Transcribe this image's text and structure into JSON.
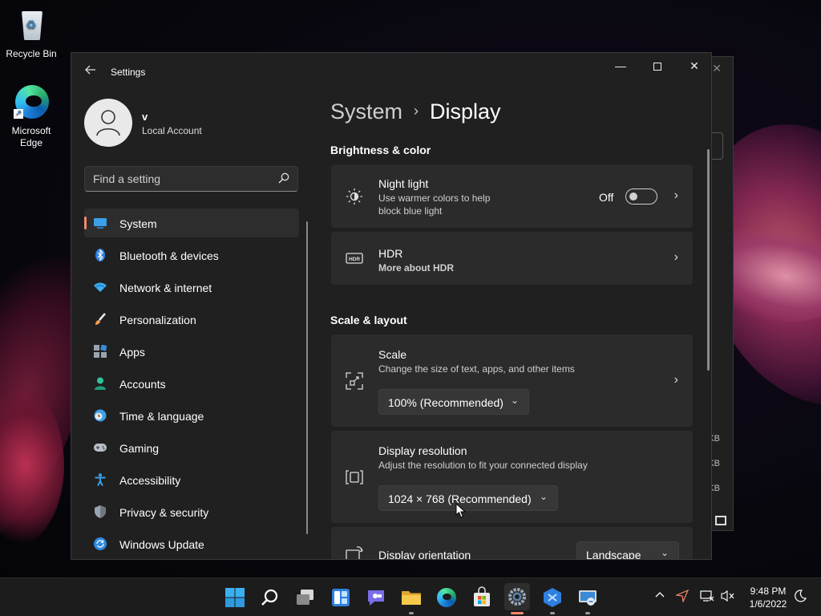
{
  "desktop": {
    "recycle_bin": "Recycle Bin",
    "edge": "Microsoft Edge"
  },
  "window": {
    "title": "Settings",
    "minimize": "—",
    "close": "✕"
  },
  "user": {
    "name": "v",
    "account": "Local Account"
  },
  "search": {
    "placeholder": "Find a setting"
  },
  "sidebar": {
    "items": [
      {
        "label": "System",
        "icon": "monitor-icon",
        "selected": true
      },
      {
        "label": "Bluetooth & devices",
        "icon": "bluetooth-icon"
      },
      {
        "label": "Network & internet",
        "icon": "wifi-icon"
      },
      {
        "label": "Personalization",
        "icon": "brush-icon"
      },
      {
        "label": "Apps",
        "icon": "apps-icon"
      },
      {
        "label": "Accounts",
        "icon": "person-icon"
      },
      {
        "label": "Time & language",
        "icon": "globe-clock-icon"
      },
      {
        "label": "Gaming",
        "icon": "gamepad-icon"
      },
      {
        "label": "Accessibility",
        "icon": "accessibility-icon"
      },
      {
        "label": "Privacy & security",
        "icon": "shield-icon"
      },
      {
        "label": "Windows Update",
        "icon": "update-icon"
      }
    ]
  },
  "breadcrumb": {
    "parent": "System",
    "separator": "›",
    "current": "Display"
  },
  "sections": {
    "brightness": "Brightness & color",
    "scale_layout": "Scale & layout"
  },
  "night_light": {
    "title": "Night light",
    "desc_line1": "Use warmer colors to help",
    "desc_line2": "block blue light",
    "state": "Off"
  },
  "hdr": {
    "title": "HDR",
    "link": "More about HDR"
  },
  "scale": {
    "title": "Scale",
    "desc": "Change the size of text, apps, and other items",
    "value": "100% (Recommended)"
  },
  "resolution": {
    "title": "Display resolution",
    "desc": "Adjust the resolution to fit your connected display",
    "value": "1024 × 768 (Recommended)"
  },
  "orientation": {
    "title": "Display orientation",
    "value": "Landscape"
  },
  "background_window": {
    "kb1": "KB",
    "kb2": "KB",
    "kb3": "KB"
  },
  "clock": {
    "time": "9:48 PM",
    "date": "1/6/2022"
  },
  "colors": {
    "accent": "#f08a6c",
    "window_bg": "#202020",
    "card_bg": "#2b2b2b"
  }
}
